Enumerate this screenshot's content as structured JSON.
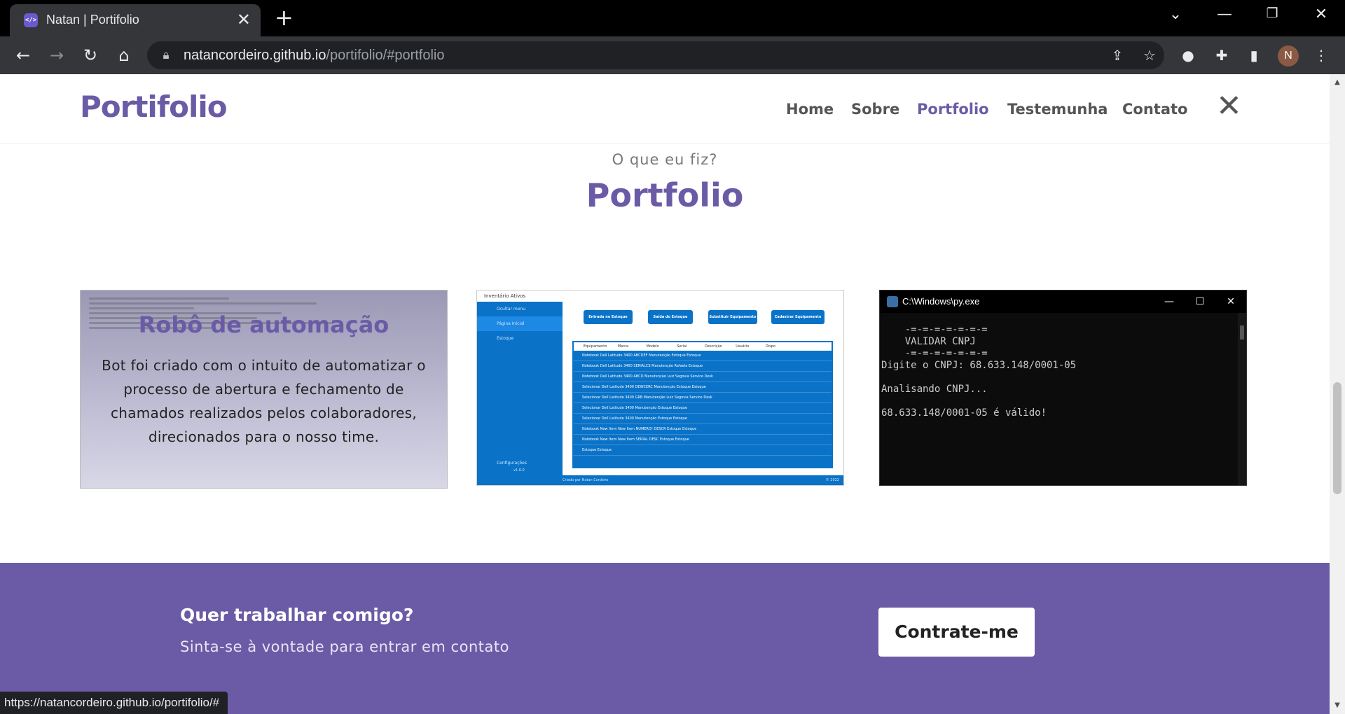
{
  "browser": {
    "tab_title": "Natan | Portifolio",
    "tab_favicon": "</>",
    "url_host": "natancordeiro.github.io",
    "url_path": "/portifolio/#portfolio",
    "status_url": "https://natancordeiro.github.io/portifolio/#",
    "avatar_initial": "N"
  },
  "site": {
    "brand": "Portifolio",
    "nav": [
      "Home",
      "Sobre",
      "Portfolio",
      "Testemunha",
      "Contato"
    ],
    "active_nav": "Portfolio"
  },
  "portfolio": {
    "subtitle": "O que eu fiz?",
    "title": "Portfolio",
    "cards": [
      {
        "title": "Robô de automação",
        "text": "Bot foi criado com o intuito de automatizar o processo de abertura e fechamento de chamados realizados pelos colaboradores, direcionados para o nosso time."
      },
      {
        "app_title": "Inventário Ativos",
        "menu": [
          "Ocultar menu",
          "Página Inicial",
          "Estoque",
          "Configurações"
        ],
        "version": "v1.0.0",
        "buttons": [
          "Entrada no Estoque",
          "Saída do Estoque",
          "Substituir Equipamento",
          "Cadastrar Equipamento"
        ],
        "table_head": [
          "Equipamento",
          "Marca",
          "Modelo",
          "Serial",
          "Descrição",
          "Usuário",
          "Dispo"
        ],
        "rows": [
          "Notebook   Dell   Latitude 3400   ABCDEF   Manutenção   Estoque   Estoque",
          "Notebook   Dell   Latitude 3400   SERIALCS   Manutenção   Rafaela   Estoque",
          "Notebook   Dell   Latitude 3400   ABCD   Manutenção   Luiz Segovia   Service Desk",
          "Selecionar   Dell   Latitude 3400   DEWCERC   Manutenção   Estoque   Estoque",
          "Selecionar   Dell   Latitude 3400   GRB   Manutenção   Luiz Segovia   Service Desk",
          "Selecionar   Dell   Latitude 3400      Manutenção   Estoque   Estoque",
          "Selecionar   Dell   Latitude 3400      Manutenção   Estoque   Estoque",
          "Notebook   New Item   New Item   NUMERO!   DESCR   Estoque   Estoque",
          "Notebook   New Item   New Item   SERIAL   DESC   Estoque   Estoque",
          "                        Estoque   Estoque"
        ],
        "footer": "Criado por Natan Cordeiro",
        "footer_right": "© 2022"
      },
      {
        "window_title": "C:\\Windows\\py.exe",
        "console": "    -=-=-=-=-=-=-=\n    VALIDAR CNPJ\n    -=-=-=-=-=-=-=\nDigite o CNPJ: 68.633.148/0001-05\n\nAnalisando CNPJ...\n\n68.633.148/0001-05 é válido!"
      }
    ]
  },
  "cta": {
    "title": "Quer trabalhar comigo?",
    "text": "Sinta-se à vontade para entrar em contato",
    "button": "Contrate-me"
  }
}
